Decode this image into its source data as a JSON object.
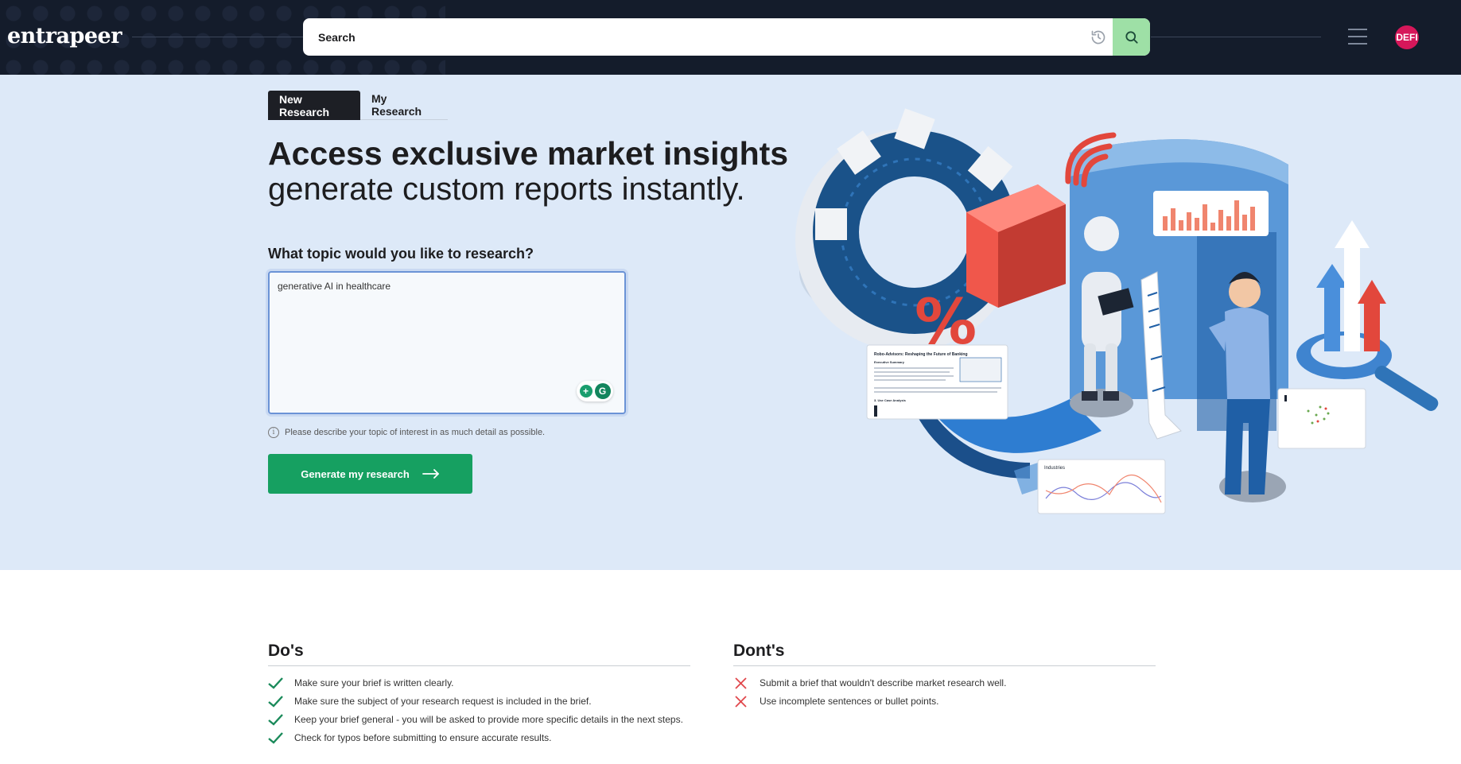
{
  "brand": {
    "logo_text": "entrapeer"
  },
  "header": {
    "search_placeholder": "Search",
    "avatar_initials": "DEFI"
  },
  "tabs": [
    {
      "label": "New Research",
      "active": true
    },
    {
      "label": "My Research",
      "active": false
    }
  ],
  "hero": {
    "headline": "Access exclusive market insights",
    "subheadline": "generate custom reports instantly."
  },
  "form": {
    "question": "What topic would you like to research?",
    "topic_value": "generative AI in healthcare",
    "hint": "Please describe your topic of interest in as much detail as possible.",
    "submit_label": "Generate my research"
  },
  "illustration": {
    "report_title": "Robo-Advisors: Reshaping the Future of Banking",
    "report_section1": "Executive Summary",
    "report_section2": "3. Use Case Analysis",
    "chart_title": "Industries",
    "percent_symbol": "%"
  },
  "dos": {
    "title": "Do's",
    "items": [
      "Make sure your brief is written clearly.",
      "Make sure the subject of your research request is included in the brief.",
      "Keep your brief general - you will be asked to provide more specific details in the next steps.",
      "Check for typos before submitting to ensure accurate results."
    ]
  },
  "donts": {
    "title": "Dont's",
    "items": [
      "Submit a brief that wouldn't describe market research well.",
      "Use incomplete sentences or bullet points."
    ]
  },
  "colors": {
    "topbar_bg": "#141c2b",
    "hero_bg": "#dde9f8",
    "primary_green": "#16a061",
    "search_button": "#9ee0a6",
    "avatar": "#d6175a",
    "check": "#1a8a5a",
    "cross": "#e0464b"
  }
}
